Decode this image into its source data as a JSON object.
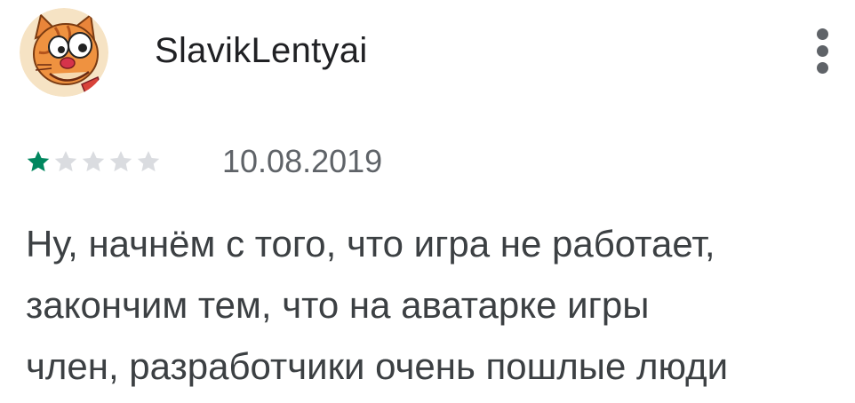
{
  "review": {
    "author": "SlavikLentyai",
    "avatar_icon": "cartoon-cat-avatar",
    "menu_icon": "more-vert-icon",
    "rating": 1,
    "rating_max": 5,
    "date": "10.08.2019",
    "text_lines": [
      "Ну, начнём с того, что игра не работает,",
      "закончим тем, что на аватарке игры",
      "член, разработчики очень пошлые люди"
    ]
  },
  "colors": {
    "star_filled": "#01875f",
    "star_empty": "#dadce0",
    "author_text": "#202124",
    "meta_text": "#5f6368",
    "body_text": "#3c4043"
  }
}
